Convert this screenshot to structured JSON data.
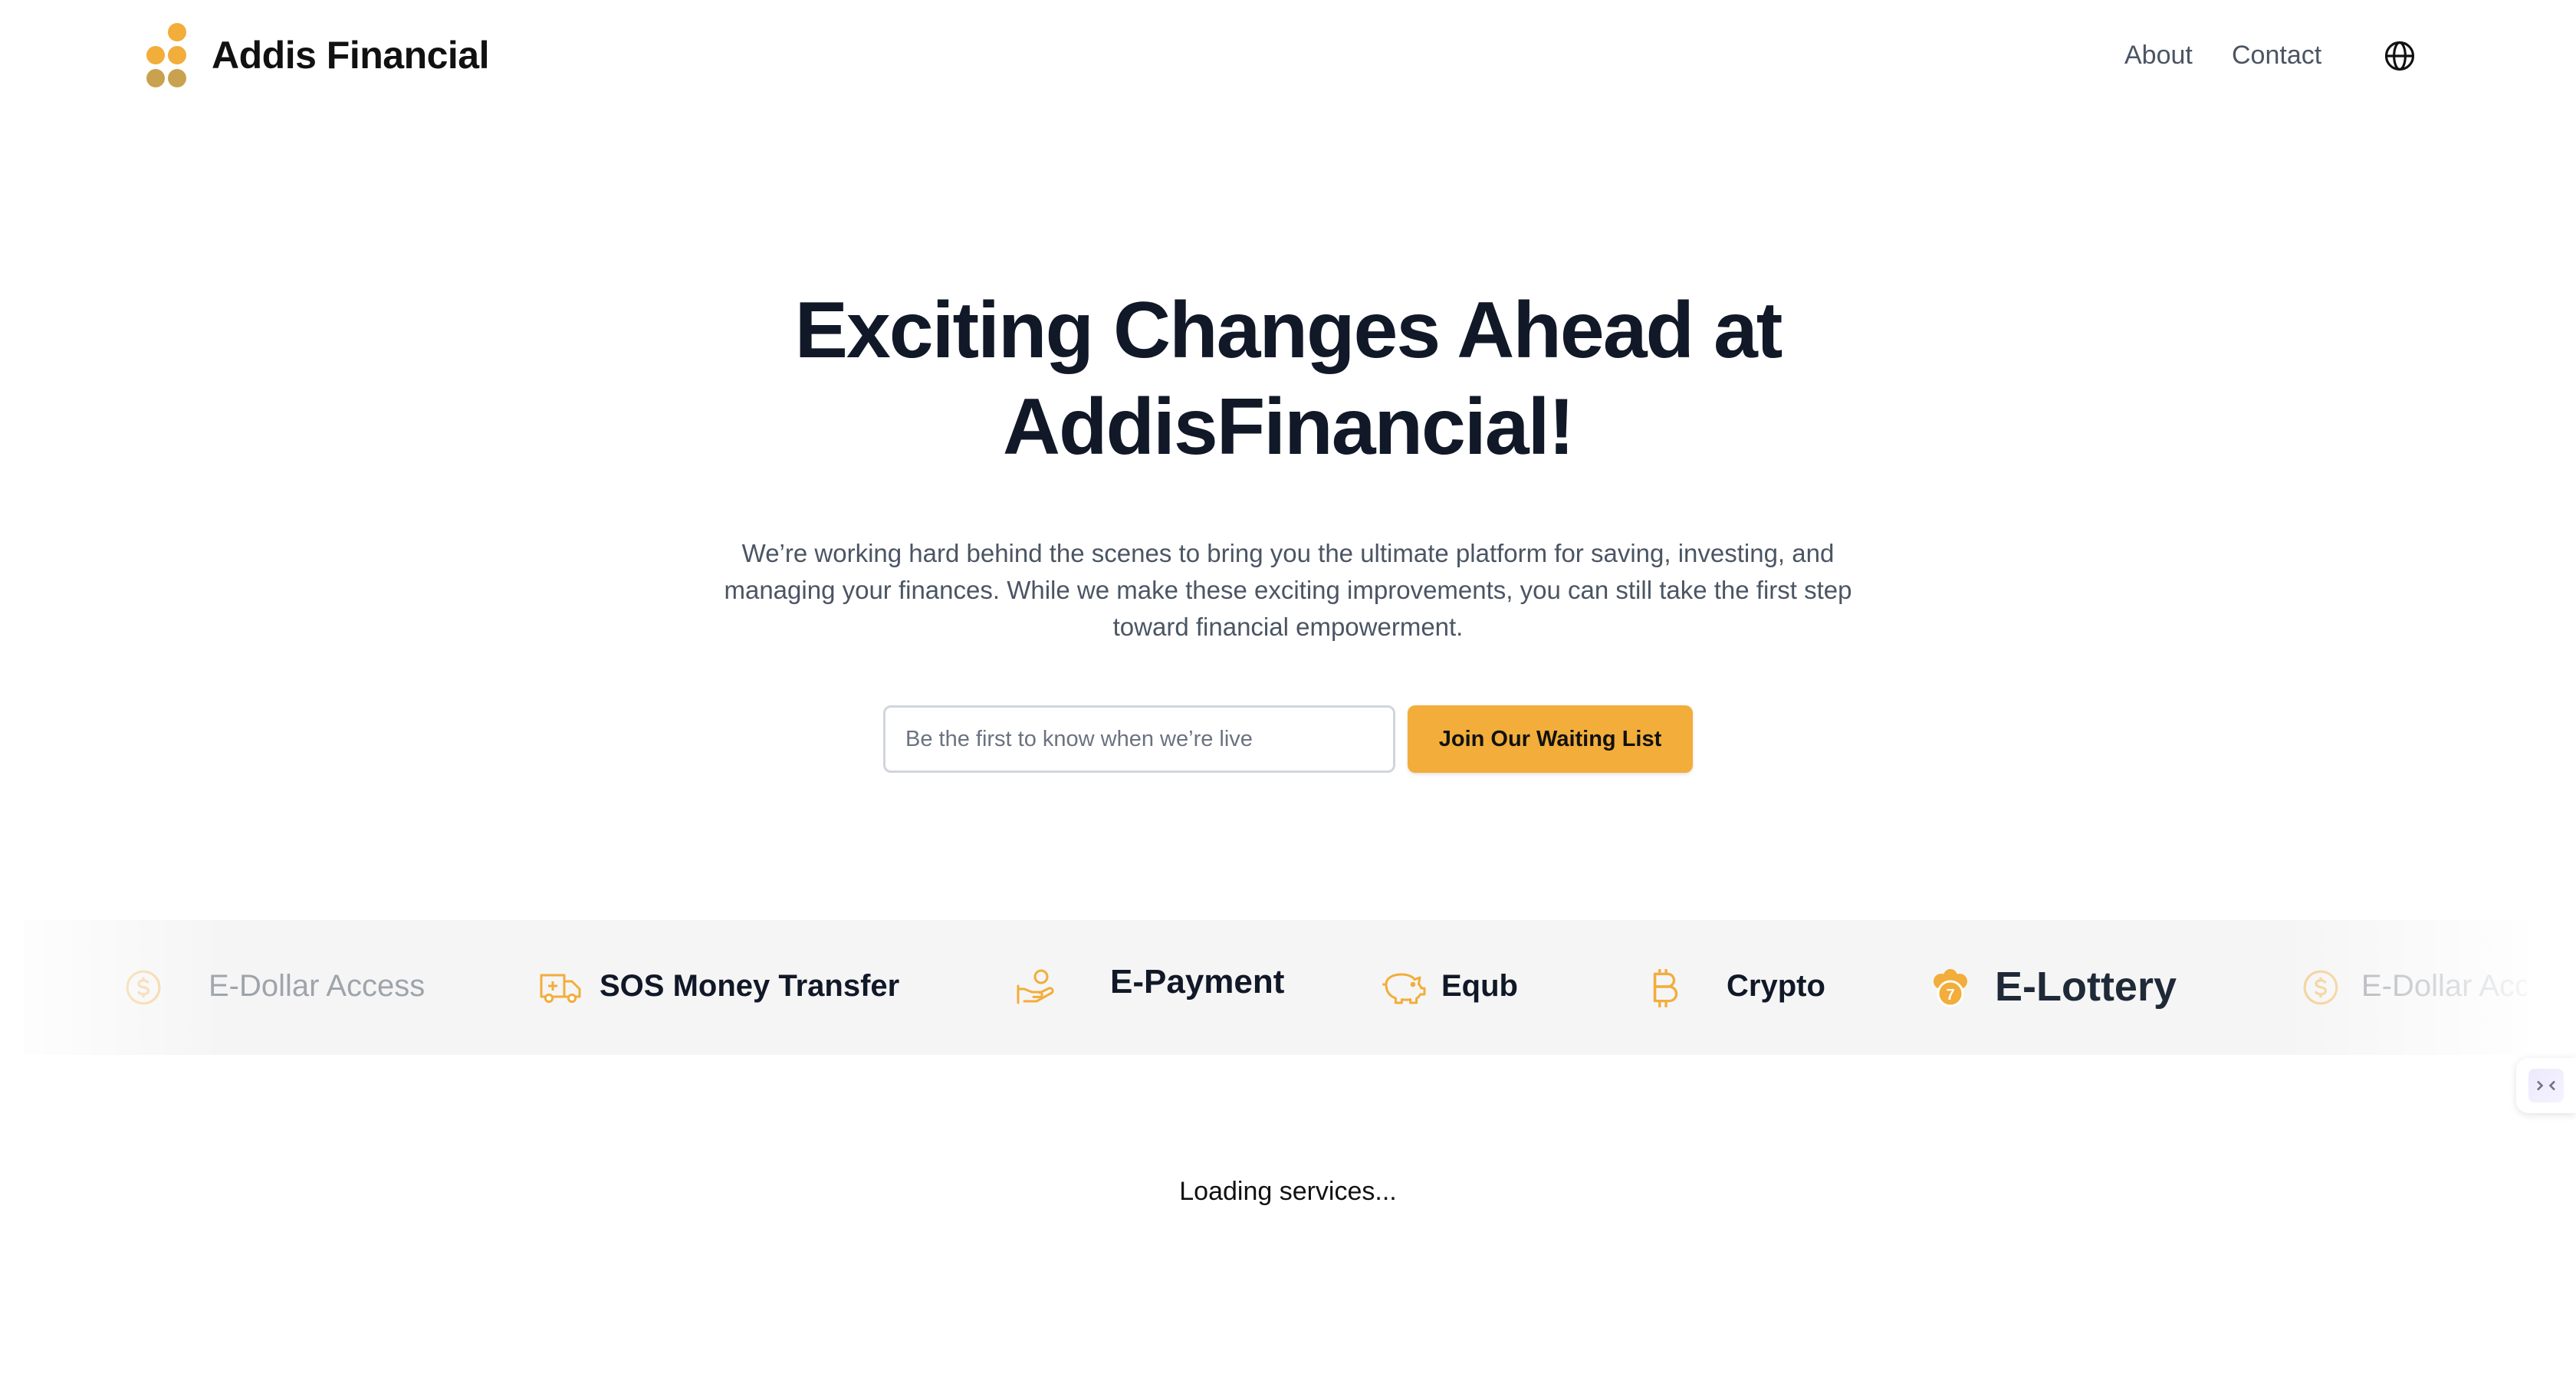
{
  "header": {
    "brand": "Addis Financial",
    "nav": {
      "about": "About",
      "contact": "Contact"
    },
    "logo_colors": [
      "#f2ad3a",
      "#f2ad3a",
      "#f2ad3a",
      "#c9a24f",
      "#c9a24f"
    ],
    "language_icon": "globe-icon"
  },
  "hero": {
    "title_line1": "Exciting Changes Ahead at",
    "title_line2": "AddisFinancial!",
    "desc_line1": "We’re working hard behind the scenes to bring you the ultimate platform for saving, investing, and",
    "desc_line2": "managing your finances. While we make these exciting improvements, you can still take the first step",
    "desc_line3": "toward financial empowerment."
  },
  "signup": {
    "placeholder": "Be the first to know when we’re live",
    "button_label": "Join Our Waiting List"
  },
  "services": [
    {
      "label": "E-Dollar Access",
      "icon": "dollar-circle-icon"
    },
    {
      "label": "SOS Money Transfer",
      "icon": "ambulance-icon"
    },
    {
      "label": "E-Payment",
      "icon": "hand-coin-icon"
    },
    {
      "label": "Equb",
      "icon": "piggy-bank-icon"
    },
    {
      "label": "Crypto",
      "icon": "bitcoin-icon"
    },
    {
      "label": "E-Lottery",
      "icon": "lottery-icon"
    },
    {
      "label": "E-Dollar Access",
      "icon": "dollar-circle-icon"
    }
  ],
  "status": {
    "loading": "Loading services..."
  },
  "colors": {
    "accent": "#f2ad3a",
    "text_dark": "#111827",
    "text_muted": "#4b5563"
  }
}
